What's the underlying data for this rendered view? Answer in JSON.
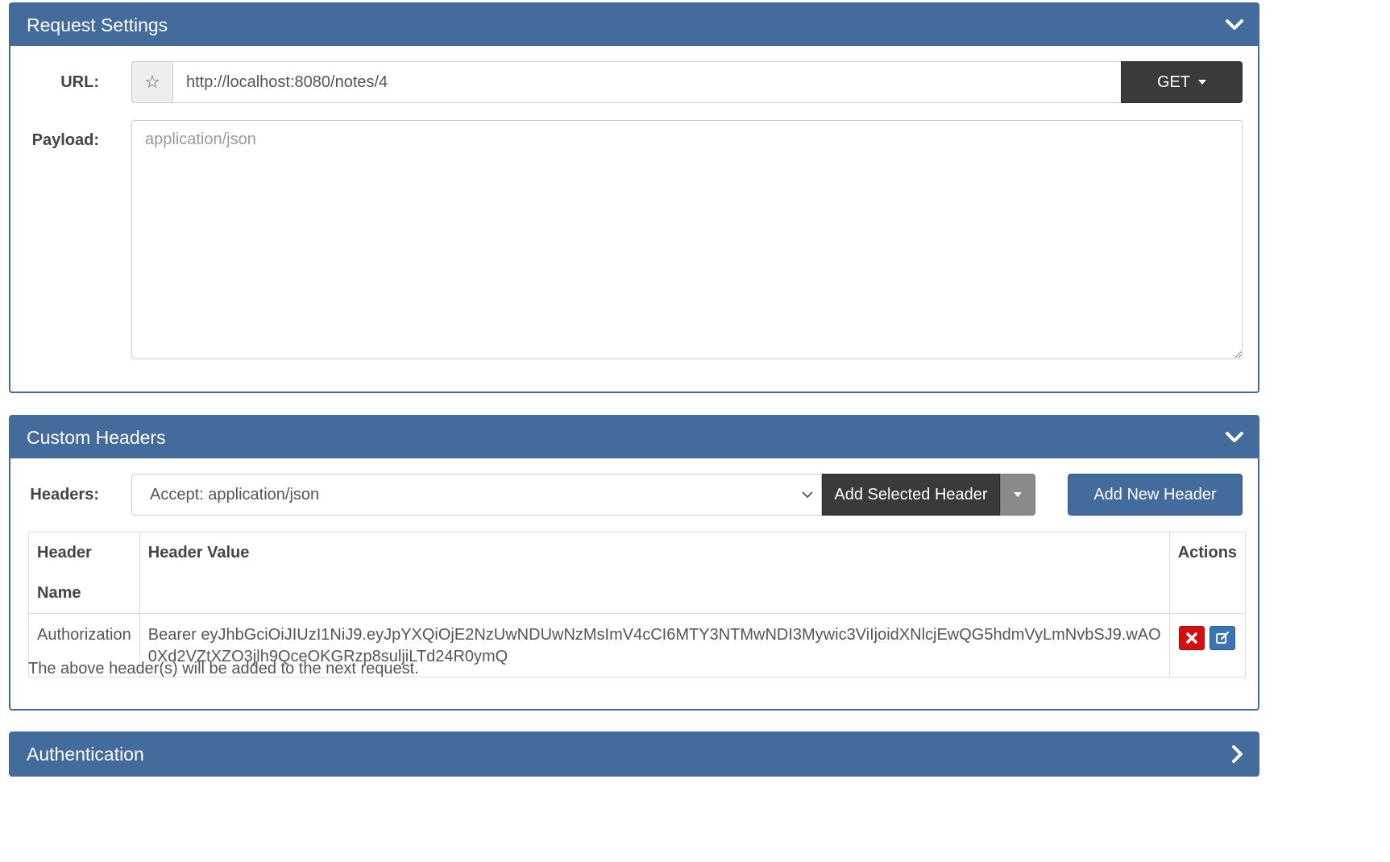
{
  "request_settings": {
    "title": "Request Settings",
    "url_label": "URL:",
    "url_value": "http://localhost:8080/notes/4",
    "method": "GET",
    "payload_label": "Payload:",
    "payload_placeholder": "application/json"
  },
  "custom_headers": {
    "title": "Custom Headers",
    "headers_label": "Headers:",
    "selected_header": "Accept: application/json",
    "add_selected_label": "Add Selected Header",
    "add_new_label": "Add New Header",
    "table": {
      "columns": [
        "Header Name",
        "Header Value",
        "Actions"
      ],
      "rows": [
        {
          "name": "Authorization",
          "value_line1": "Bearer eyJhbGciOiJIUzI1NiJ9.eyJpYXQiOjE2NzUwNDUwNzMsImV4cCI6MTY3NTMwNDI3Mywic3ViIjoidXNlcjEwQG5hdmVyLmNvbSJ9.wAO",
          "value_line2": "0Xd2VZtXZO3jlh9QceOKGRzp8suljiLTd24R0ymQ"
        }
      ]
    },
    "note": "The above header(s) will be added to the next request."
  },
  "authentication": {
    "title": "Authentication"
  },
  "icons": {
    "favorite": "star-outline-icon",
    "collapse": "chevron-down-icon",
    "expand": "chevron-right-icon",
    "delete": "close-icon",
    "edit": "edit-icon"
  },
  "colors": {
    "panel_header": "#436c9c",
    "dark_button": "#3a3a3a",
    "delete_button": "#d50f0f",
    "edit_button": "#3a74b5"
  }
}
